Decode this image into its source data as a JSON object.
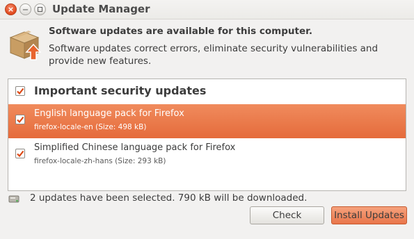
{
  "window": {
    "title": "Update Manager",
    "controls": {
      "close_glyph": "×",
      "minimize_glyph": "—"
    }
  },
  "header": {
    "icon": "package-upgrade-icon",
    "headline": "Software updates are available for this computer.",
    "description": "Software updates correct errors, eliminate security vulnerabilities and provide new features."
  },
  "updates": {
    "group": {
      "label": "Important security updates",
      "checked": true
    },
    "items": [
      {
        "name": "English language pack for Firefox",
        "detail": "firefox-locale-en (Size: 498 kB)",
        "checked": true,
        "selected": true
      },
      {
        "name": "Simplified Chinese language pack for Firefox",
        "detail": "firefox-locale-zh-hans (Size: 293 kB)",
        "checked": true,
        "selected": false
      }
    ]
  },
  "status": {
    "icon": "disk-status-icon",
    "text": "2 updates have been selected. 790 kB will be downloaded."
  },
  "buttons": {
    "check": "Check",
    "install": "Install Updates"
  },
  "colors": {
    "accent": "#e56b3b",
    "selection": "#ed7b4b",
    "checkmark": "#dd4814",
    "background": "#f2f1f0"
  }
}
